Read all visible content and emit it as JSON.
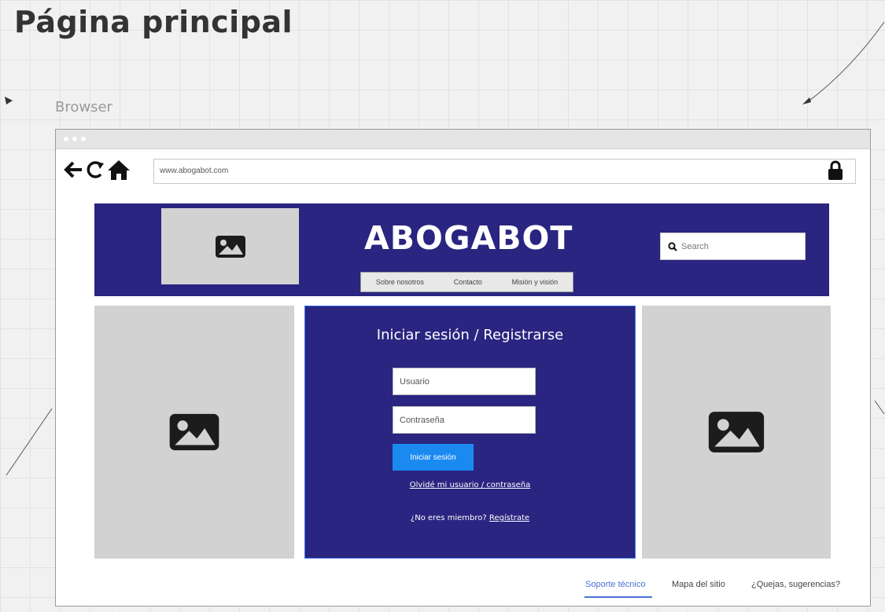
{
  "page": {
    "title": "Página principal"
  },
  "mockup": {
    "label": "Browser"
  },
  "browser": {
    "url": "www.abogabot.com",
    "icons": [
      "back-arrow-icon",
      "reload-icon",
      "home-icon",
      "lock-icon"
    ]
  },
  "site": {
    "brand": "ABOGABOT",
    "nav": [
      "Sobre nosotros",
      "Contacto",
      "Misión y visión"
    ],
    "search_placeholder": "Search",
    "colors": {
      "header_bg": "#292580",
      "panel_bg": "#292580",
      "button_bg": "#1a8af1",
      "placeholder_bg": "#d2d2d2"
    }
  },
  "login": {
    "title": "Iniciar sesión / Registrarse",
    "username_placeholder": "Usuario",
    "password_placeholder": "Contraseña",
    "submit_label": "Iniciar sesión",
    "forgot_link": "Olvidé mi usuario / contraseña",
    "register_prompt": "¿No eres miembro?",
    "register_link": "Regístrate"
  },
  "footer": {
    "links": [
      "Soporte técnico",
      "Mapa del sitio",
      "¿Quejas, sugerencias?"
    ],
    "active_link": "Soporte técnico"
  }
}
